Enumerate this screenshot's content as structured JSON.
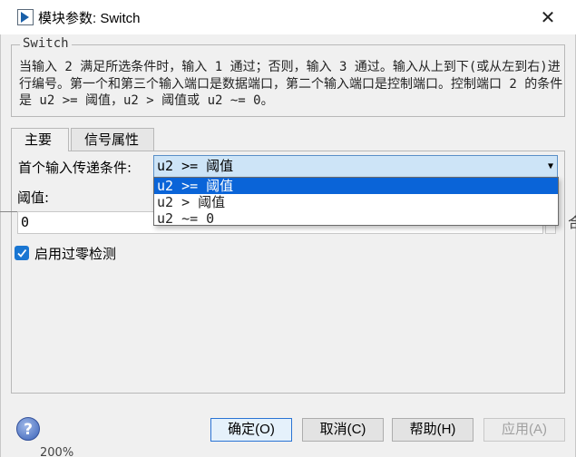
{
  "window": {
    "title": "模块参数: Switch",
    "close_glyph": "✕"
  },
  "group": {
    "legend": "Switch",
    "description": "当输入 2 满足所选条件时，输入 1 通过；否则，输入 3 通过。输入从上到下(或从左到右)进行编号。第一个和第三个输入端口是数据端口，第二个输入端口是控制端口。控制端口 2 的条件是 u2 >= 阈值，u2 > 阈值或 u2 ~= 0。"
  },
  "tabs": [
    {
      "label": "主要",
      "active": true
    },
    {
      "label": "信号属性",
      "active": false
    }
  ],
  "criteria": {
    "label": "首个输入传递条件:",
    "selected": "u2 >= 阈值",
    "options": [
      "u2 >= 阈值",
      "u2 > 阈值",
      "u2 ~= 0"
    ],
    "selected_index": 0
  },
  "threshold": {
    "label": "阈值:",
    "value": "0"
  },
  "zero_crossing": {
    "label": "启用过零检测",
    "checked": true
  },
  "buttons": {
    "help_glyph": "?",
    "ok": "确定(O)",
    "cancel": "取消(C)",
    "help": "帮助(H)",
    "apply": "应用(A)"
  },
  "background": {
    "zoom": "200%",
    "stray_glyph": "合"
  },
  "colors": {
    "accent": "#0a64d8",
    "combo_bg": "#cde4f7",
    "checkbox": "#1976d2"
  }
}
